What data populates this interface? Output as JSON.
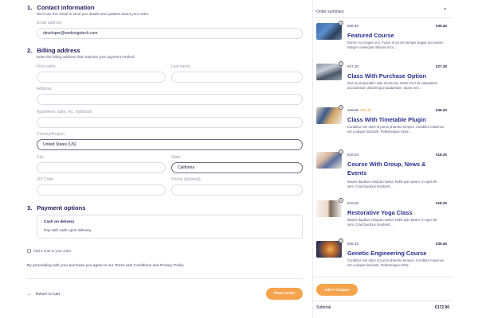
{
  "contact": {
    "number": "1.",
    "title": "Contact information",
    "desc": "We'll use this email to send you details and updates about your order.",
    "email_label": "Email address",
    "email_value": "developer@wedesigntech.com"
  },
  "billing": {
    "number": "2.",
    "title": "Billing address",
    "desc": "Enter the billing address that matches your payment method.",
    "first_name_label": "First name",
    "last_name_label": "Last name",
    "address_label": "Address",
    "apartment_label": "Apartment, suite, etc. (optional)",
    "country_label": "Country/Region",
    "country_value": "United States (US)",
    "city_label": "City",
    "state_label": "State",
    "state_value": "California",
    "zip_label": "ZIP Code",
    "phone_label": "Phone (optional)"
  },
  "payment": {
    "number": "3.",
    "title": "Payment options",
    "method_title": "Cash on delivery",
    "method_desc": "Pay with cash upon delivery."
  },
  "note_label": "Add a note to your order",
  "terms_text": "By proceeding with your purchase you agree to our Terms and Conditions and Privacy Policy",
  "return_label": "Return to Cart",
  "place_order_label": "Place Order",
  "summary": {
    "title": "Order summary",
    "items": [
      {
        "qty": "1",
        "price": "€36.40",
        "old_price": "",
        "sale_price": "",
        "title": "Featured Course",
        "desc": "Donec eu congue orci. Fusce ut eu est semper augue accumsan. Integer consequat ultricies arcu...",
        "total": "€36.40"
      },
      {
        "qty": "1",
        "price": "€27.30",
        "old_price": "",
        "sale_price": "",
        "title": "Class With Purchase Option",
        "desc": "Sed ut perspiciatis unde omnis iste natus error sit voluptatem accusantium doloremque laudantium, totam rem...",
        "total": "€27.30"
      },
      {
        "qty": "1",
        "price": "",
        "old_price": "€40.95",
        "sale_price": "€36.40",
        "title": "Class With Timetable Plugin",
        "desc": "Curabitur non dolor id purus pharetra tempus. Curabitur maximus est a aliquet tincidunt. Pellentesque tortor...",
        "total": "€36.40"
      },
      {
        "qty": "1",
        "price": "€18.20",
        "old_price": "",
        "sale_price": "",
        "title": "Course With Group, News & Events",
        "desc": "Mauris dapibus volutpat massa. Nulla quis ipsum. In eget elit sem. Cras faucibus hendrerit...",
        "total": "€18.20"
      },
      {
        "qty": "1",
        "price": "€18.20",
        "old_price": "",
        "sale_price": "",
        "title": "Restorative Yoga Class",
        "desc": "Mauris dapibus volutpat massa. Nulla quis ipsum. In eget elit sem. Cras faucibus hendrerit...",
        "total": "€18.20"
      },
      {
        "qty": "1",
        "price": "€36.40",
        "old_price": "",
        "sale_price": "",
        "title": "Genetic Engineering Course",
        "desc": "Curabitur non dolor id purus pharetra tempus. Curabitur maximus est a aliquet tincidunt. Pellentesque tortor...",
        "total": "€36.40"
      }
    ],
    "coupon_label": "Add A Coupon",
    "subtotal_label": "Subtotal",
    "subtotal_value": "€172.90"
  },
  "colors": {
    "accent": "#f5a34c",
    "title_blue": "#2a2f8f",
    "heading": "#1f1b5c"
  },
  "icons": {
    "summary_toggle": "chevron-up-icon",
    "return": "arrow-left-icon"
  }
}
